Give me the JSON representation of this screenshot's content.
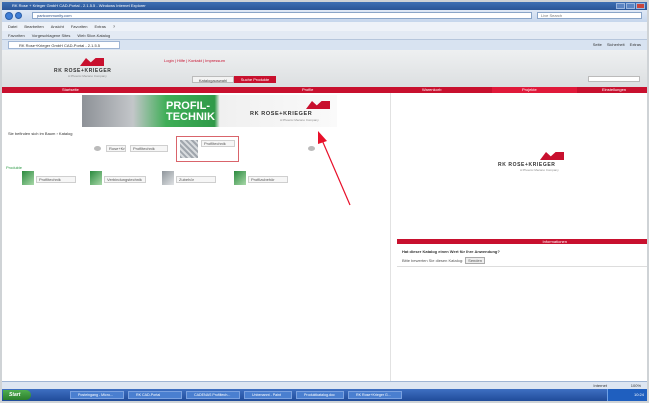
{
  "browser": {
    "title": "RK Rose + Krieger GmbH CAD-Portal - 2.1.5.5 - Windows Internet Explorer",
    "address": "partcommunity.com",
    "search_placeholder": "Live Search",
    "menu": [
      "Datei",
      "Bearbeiten",
      "Ansicht",
      "Favoriten",
      "Extras",
      "?"
    ],
    "favorites": [
      "Favoriten",
      "Vorgeschlagene Sites",
      "Web Slice-Katalog"
    ],
    "tab": "RK Rose+Krieger GmbH CAD-Portal - 2.1.5.5",
    "toolbar": [
      "Seite",
      "Sicherheit",
      "Extras"
    ]
  },
  "site": {
    "logo_text": "RK ROSE+KRIEGER",
    "logo_tagline": "A Phoenix Mecano Company",
    "top_links": "Login | Hilfe | Kontakt | Impressum",
    "nav_buttons": [
      "Katalogauswahl",
      "Suche Produkte"
    ],
    "red_nav": [
      "Startseite",
      "Profile",
      "Warenkorb",
      "Projekte",
      "Einstellungen"
    ]
  },
  "banner": {
    "headline_1": "PROFIL-",
    "headline_2": "TECHNIK",
    "brand": "RK ROSE+KRIEGER",
    "tagline": "A Phoenix Mecano Company"
  },
  "breadcrumb": "Sie befinden sich im Baum › Katalog",
  "tree": {
    "nodes": [
      "Rose+Krieger",
      "Profiltechnik",
      "Profiltechnik"
    ]
  },
  "section": {
    "label": "Produkte",
    "items": [
      "Profiltechnik",
      "Verbindungstechnik",
      "Zubehör",
      "Profilzubehör"
    ]
  },
  "info": {
    "bar": "Informationen",
    "question": "Hat dieser Katalog einen Wert für Ihre Anwendung?",
    "answer": "Bitte bewerten Sie diesen Katalog:",
    "button": "Senden"
  },
  "status": {
    "zone": "Internet",
    "zoom": "100%"
  },
  "taskbar": {
    "start": "Start",
    "buttons": [
      "Posteingang - Micro...",
      "RK CAD-Portal",
      "CADENAS Profiltech...",
      "Unbenannt - Paint",
      "Produktkatalog.doc",
      "RK Rose+Krieger G..."
    ],
    "clock": "10:24"
  },
  "colors": {
    "brand_red": "#c8102e",
    "profile_green": "#2f9a48"
  }
}
